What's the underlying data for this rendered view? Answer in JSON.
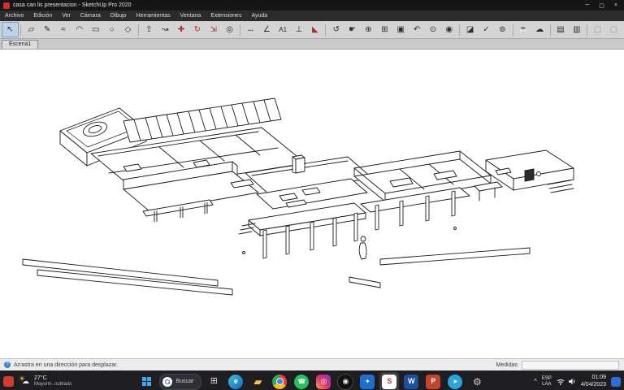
{
  "window": {
    "title": "casa can lis presentacion - SketchUp Pro 2020",
    "controls": {
      "minimize": "─",
      "maximize": "▢",
      "close": "×"
    }
  },
  "menu": {
    "items": [
      "Archivo",
      "Edición",
      "Ver",
      "Cámara",
      "Dibujo",
      "Herramientas",
      "Ventana",
      "Extensiones",
      "Ayuda"
    ]
  },
  "toolbar": {
    "tools": [
      {
        "name": "select",
        "glyph": "↖"
      },
      {
        "name": "eraser",
        "glyph": "▱"
      },
      {
        "name": "line",
        "glyph": "✎"
      },
      {
        "name": "freehand",
        "glyph": "≈"
      },
      {
        "name": "arc",
        "glyph": "◠"
      },
      {
        "name": "rectangle",
        "glyph": "▭"
      },
      {
        "name": "circle",
        "glyph": "○"
      },
      {
        "name": "polygon",
        "glyph": "◇"
      },
      {
        "name": "push-pull",
        "glyph": "⇧"
      },
      {
        "name": "follow-me",
        "glyph": "↝"
      },
      {
        "name": "move",
        "glyph": "✚"
      },
      {
        "name": "rotate",
        "glyph": "↻"
      },
      {
        "name": "scale",
        "glyph": "⇲"
      },
      {
        "name": "offset",
        "glyph": "◎"
      },
      {
        "name": "tape-measure",
        "glyph": "↔"
      },
      {
        "name": "protractor",
        "glyph": "∠"
      },
      {
        "name": "text",
        "glyph": "A1"
      },
      {
        "name": "axes",
        "glyph": "⊥"
      },
      {
        "name": "paint-bucket",
        "glyph": "◣"
      },
      {
        "name": "orbit",
        "glyph": "↺"
      },
      {
        "name": "pan",
        "glyph": "☛"
      },
      {
        "name": "zoom",
        "glyph": "⊕"
      },
      {
        "name": "zoom-window",
        "glyph": "⊞"
      },
      {
        "name": "zoom-extents",
        "glyph": "▣"
      },
      {
        "name": "previous-view",
        "glyph": "↶"
      },
      {
        "name": "position-camera",
        "glyph": "⊙"
      },
      {
        "name": "look-around",
        "glyph": "◉"
      },
      {
        "name": "section-plane",
        "glyph": "◪"
      },
      {
        "name": "check-model",
        "glyph": "✓"
      },
      {
        "name": "solid-tools",
        "glyph": "⊚"
      },
      {
        "name": "extension-warehouse",
        "glyph": "☕"
      },
      {
        "name": "3d-warehouse",
        "glyph": "☁"
      },
      {
        "name": "style-edit",
        "glyph": "▤"
      },
      {
        "name": "style-display",
        "glyph": "▥"
      },
      {
        "name": "extra-a",
        "glyph": "▢"
      },
      {
        "name": "extra-b",
        "glyph": "▢"
      }
    ]
  },
  "scene_tab": "Escena1",
  "status": {
    "help": "?",
    "hint": "Arrastra en una dirección para desplazar.",
    "measurements_label": "Medidas"
  },
  "taskbar": {
    "weather": {
      "temp": "27°C",
      "desc": "Mayorm. nublado"
    },
    "search": {
      "label": "Buscar"
    },
    "apps": [
      {
        "name": "task-view",
        "glyph": "⊞"
      },
      {
        "name": "edge",
        "glyph": "e"
      },
      {
        "name": "file-explorer",
        "glyph": "▰"
      },
      {
        "name": "chrome",
        "glyph": ""
      },
      {
        "name": "whatsapp",
        "glyph": "☎"
      },
      {
        "name": "instagram",
        "glyph": "◎"
      },
      {
        "name": "camera",
        "glyph": "◉"
      },
      {
        "name": "photos",
        "glyph": "✦"
      },
      {
        "name": "sketchup",
        "glyph": "S"
      },
      {
        "name": "word",
        "glyph": "W"
      },
      {
        "name": "powerpoint",
        "glyph": "P"
      },
      {
        "name": "telegram",
        "glyph": "➤"
      },
      {
        "name": "settings",
        "glyph": "⚙"
      }
    ],
    "tray": {
      "expand": "^",
      "lang_line1": "ESP",
      "lang_line2": "LAA",
      "time": "01:09",
      "date": "4/04/2023"
    }
  }
}
